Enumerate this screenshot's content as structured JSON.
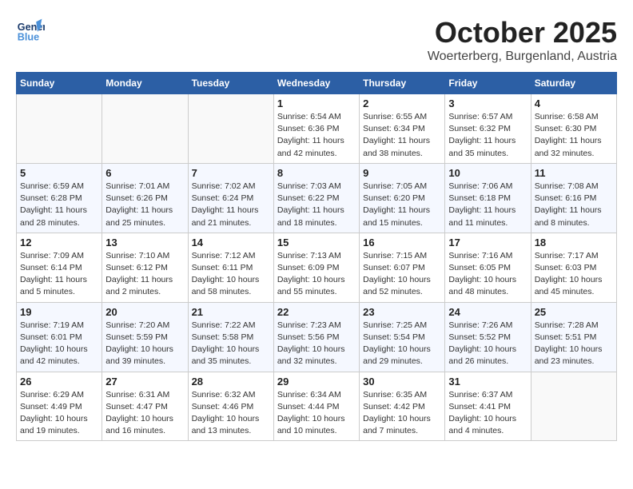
{
  "header": {
    "logo_general": "General",
    "logo_blue": "Blue",
    "month_year": "October 2025",
    "location": "Woerterberg, Burgenland, Austria"
  },
  "days_of_week": [
    "Sunday",
    "Monday",
    "Tuesday",
    "Wednesday",
    "Thursday",
    "Friday",
    "Saturday"
  ],
  "weeks": [
    [
      {
        "day": "",
        "info": ""
      },
      {
        "day": "",
        "info": ""
      },
      {
        "day": "",
        "info": ""
      },
      {
        "day": "1",
        "info": "Sunrise: 6:54 AM\nSunset: 6:36 PM\nDaylight: 11 hours\nand 42 minutes."
      },
      {
        "day": "2",
        "info": "Sunrise: 6:55 AM\nSunset: 6:34 PM\nDaylight: 11 hours\nand 38 minutes."
      },
      {
        "day": "3",
        "info": "Sunrise: 6:57 AM\nSunset: 6:32 PM\nDaylight: 11 hours\nand 35 minutes."
      },
      {
        "day": "4",
        "info": "Sunrise: 6:58 AM\nSunset: 6:30 PM\nDaylight: 11 hours\nand 32 minutes."
      }
    ],
    [
      {
        "day": "5",
        "info": "Sunrise: 6:59 AM\nSunset: 6:28 PM\nDaylight: 11 hours\nand 28 minutes."
      },
      {
        "day": "6",
        "info": "Sunrise: 7:01 AM\nSunset: 6:26 PM\nDaylight: 11 hours\nand 25 minutes."
      },
      {
        "day": "7",
        "info": "Sunrise: 7:02 AM\nSunset: 6:24 PM\nDaylight: 11 hours\nand 21 minutes."
      },
      {
        "day": "8",
        "info": "Sunrise: 7:03 AM\nSunset: 6:22 PM\nDaylight: 11 hours\nand 18 minutes."
      },
      {
        "day": "9",
        "info": "Sunrise: 7:05 AM\nSunset: 6:20 PM\nDaylight: 11 hours\nand 15 minutes."
      },
      {
        "day": "10",
        "info": "Sunrise: 7:06 AM\nSunset: 6:18 PM\nDaylight: 11 hours\nand 11 minutes."
      },
      {
        "day": "11",
        "info": "Sunrise: 7:08 AM\nSunset: 6:16 PM\nDaylight: 11 hours\nand 8 minutes."
      }
    ],
    [
      {
        "day": "12",
        "info": "Sunrise: 7:09 AM\nSunset: 6:14 PM\nDaylight: 11 hours\nand 5 minutes."
      },
      {
        "day": "13",
        "info": "Sunrise: 7:10 AM\nSunset: 6:12 PM\nDaylight: 11 hours\nand 2 minutes."
      },
      {
        "day": "14",
        "info": "Sunrise: 7:12 AM\nSunset: 6:11 PM\nDaylight: 10 hours\nand 58 minutes."
      },
      {
        "day": "15",
        "info": "Sunrise: 7:13 AM\nSunset: 6:09 PM\nDaylight: 10 hours\nand 55 minutes."
      },
      {
        "day": "16",
        "info": "Sunrise: 7:15 AM\nSunset: 6:07 PM\nDaylight: 10 hours\nand 52 minutes."
      },
      {
        "day": "17",
        "info": "Sunrise: 7:16 AM\nSunset: 6:05 PM\nDaylight: 10 hours\nand 48 minutes."
      },
      {
        "day": "18",
        "info": "Sunrise: 7:17 AM\nSunset: 6:03 PM\nDaylight: 10 hours\nand 45 minutes."
      }
    ],
    [
      {
        "day": "19",
        "info": "Sunrise: 7:19 AM\nSunset: 6:01 PM\nDaylight: 10 hours\nand 42 minutes."
      },
      {
        "day": "20",
        "info": "Sunrise: 7:20 AM\nSunset: 5:59 PM\nDaylight: 10 hours\nand 39 minutes."
      },
      {
        "day": "21",
        "info": "Sunrise: 7:22 AM\nSunset: 5:58 PM\nDaylight: 10 hours\nand 35 minutes."
      },
      {
        "day": "22",
        "info": "Sunrise: 7:23 AM\nSunset: 5:56 PM\nDaylight: 10 hours\nand 32 minutes."
      },
      {
        "day": "23",
        "info": "Sunrise: 7:25 AM\nSunset: 5:54 PM\nDaylight: 10 hours\nand 29 minutes."
      },
      {
        "day": "24",
        "info": "Sunrise: 7:26 AM\nSunset: 5:52 PM\nDaylight: 10 hours\nand 26 minutes."
      },
      {
        "day": "25",
        "info": "Sunrise: 7:28 AM\nSunset: 5:51 PM\nDaylight: 10 hours\nand 23 minutes."
      }
    ],
    [
      {
        "day": "26",
        "info": "Sunrise: 6:29 AM\nSunset: 4:49 PM\nDaylight: 10 hours\nand 19 minutes."
      },
      {
        "day": "27",
        "info": "Sunrise: 6:31 AM\nSunset: 4:47 PM\nDaylight: 10 hours\nand 16 minutes."
      },
      {
        "day": "28",
        "info": "Sunrise: 6:32 AM\nSunset: 4:46 PM\nDaylight: 10 hours\nand 13 minutes."
      },
      {
        "day": "29",
        "info": "Sunrise: 6:34 AM\nSunset: 4:44 PM\nDaylight: 10 hours\nand 10 minutes."
      },
      {
        "day": "30",
        "info": "Sunrise: 6:35 AM\nSunset: 4:42 PM\nDaylight: 10 hours\nand 7 minutes."
      },
      {
        "day": "31",
        "info": "Sunrise: 6:37 AM\nSunset: 4:41 PM\nDaylight: 10 hours\nand 4 minutes."
      },
      {
        "day": "",
        "info": ""
      }
    ]
  ]
}
